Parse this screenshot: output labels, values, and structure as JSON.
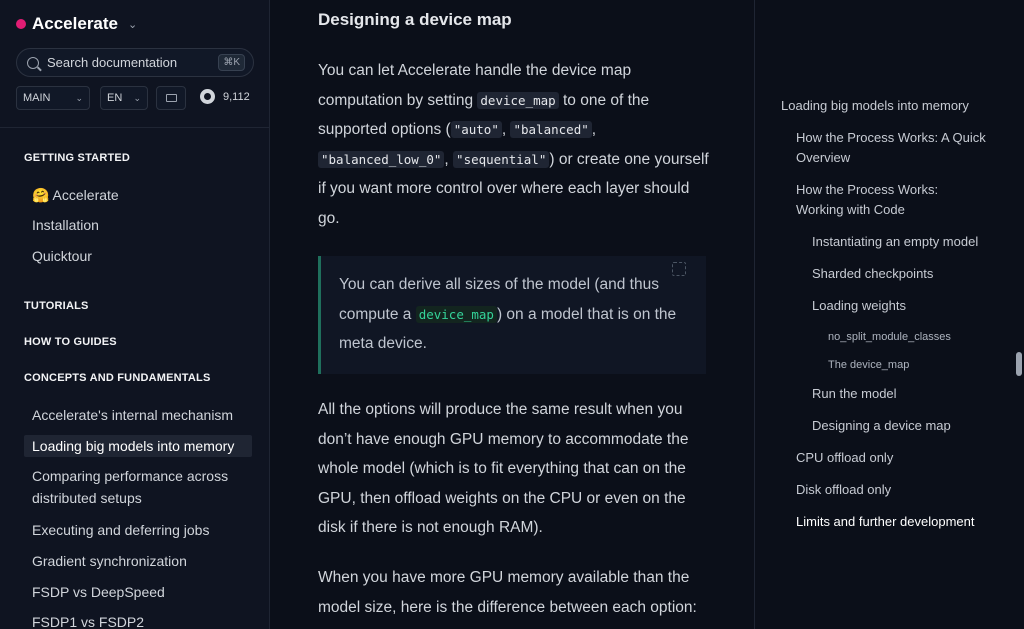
{
  "sidebar": {
    "brand": "Accelerate",
    "search": {
      "placeholder": "Search documentation",
      "shortcut": "⌘K"
    },
    "version_select": "MAIN",
    "lang_select": "EN",
    "github_stars": "9,112",
    "sections": {
      "getting_started": "GETTING STARTED",
      "tutorials": "TUTORIALS",
      "how_to_guides": "HOW TO GUIDES",
      "concepts": "CONCEPTS AND FUNDAMENTALS"
    },
    "items": {
      "accelerate": "🤗 Accelerate",
      "installation": "Installation",
      "quicktour": "Quicktour",
      "internal_mechanism": "Accelerate's internal mechanism",
      "big_models": "Loading big models into memory",
      "comparing": "Comparing performance across distributed setups",
      "executing": "Executing and deferring jobs",
      "grad_sync": "Gradient synchronization",
      "fsdp_deepspeed": "FSDP vs DeepSpeed",
      "fsdp1_fsdp2": "FSDP1 vs FSDP2"
    }
  },
  "main": {
    "heading": "Designing a device map",
    "p1_a": "You can let Accelerate handle the device map computation by setting ",
    "p1_code1": "device_map",
    "p1_b": " to one of the supported options (",
    "p1_code2": "\"auto\"",
    "p1_c": ", ",
    "p1_code3": "\"balanced\"",
    "p1_d": ", ",
    "p1_code4": "\"balanced_low_0\"",
    "p1_e": ", ",
    "p1_code5": "\"sequential\"",
    "p1_f": ") or create one yourself if you want more control over where each layer should go.",
    "tip_a": "You can derive all sizes of the model (and thus compute a ",
    "tip_code": "device_map",
    "tip_b": ") on a model that is on the meta device.",
    "p2": "All the options will produce the same result when you don’t have enough GPU memory to accommodate the whole model (which is to fit everything that can on the GPU, then offload weights on the CPU or even on the disk if there is not enough RAM).",
    "p3": "When you have more GPU memory available than the model size, here is the difference between each option:"
  },
  "toc": {
    "items": {
      "big_models": "Loading big models into memory",
      "how_quick": "How the Process Works: A Quick Overview",
      "how_code": "How the Process Works: Working with Code",
      "empty_model": "Instantiating an empty model",
      "sharded": "Sharded checkpoints",
      "loading_weights": "Loading weights",
      "no_split": "no_split_module_classes",
      "device_map": "The device_map",
      "run_model": "Run the model",
      "designing": "Designing a device map",
      "cpu_offload": "CPU offload only",
      "disk_offload": "Disk offload only",
      "limits": "Limits and further development"
    }
  }
}
